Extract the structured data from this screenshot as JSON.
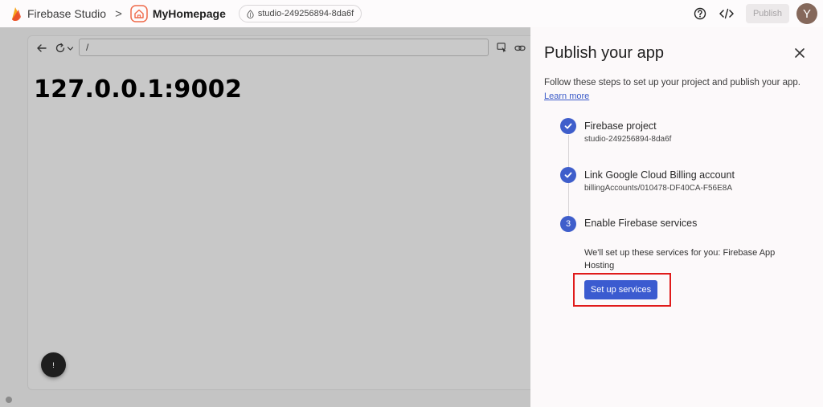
{
  "topbar": {
    "brand": "Firebase Studio",
    "separator": ">",
    "project_name": "MyHomepage",
    "workspace_chip": "studio-249256894-8da6f",
    "publish_label": "Publish",
    "avatar_initial": "Y"
  },
  "preview": {
    "url_value": "/",
    "page_heading": "127.0.0.1:9002",
    "fab_glyph": "!"
  },
  "panel": {
    "title": "Publish your app",
    "description": "Follow these steps to set up your project and publish your app.",
    "learn_more": "Learn more",
    "steps": [
      {
        "number": "",
        "status": "complete",
        "title": "Firebase project",
        "subtitle": "studio-249256894-8da6f"
      },
      {
        "number": "",
        "status": "complete",
        "title": "Link Google Cloud Billing account",
        "subtitle": "billingAccounts/010478-DF40CA-F56E8A"
      },
      {
        "number": "3",
        "status": "current",
        "title": "Enable Firebase services",
        "subtitle": ""
      }
    ],
    "services_text": "We'll set up these services for you: Firebase App Hosting",
    "setup_button": "Set up services"
  },
  "colors": {
    "accent": "#3f5ecb",
    "highlight": "#e01b1b",
    "preview_bg": "#c4c4c4"
  },
  "icons": [
    "firebase-flame-icon",
    "chevron-right-icon",
    "home-icon",
    "workspace-icon",
    "help-icon",
    "code-icon",
    "back-arrow-icon",
    "reload-icon",
    "chevron-down-icon",
    "inspect-icon",
    "link-icon",
    "close-icon",
    "check-icon"
  ]
}
